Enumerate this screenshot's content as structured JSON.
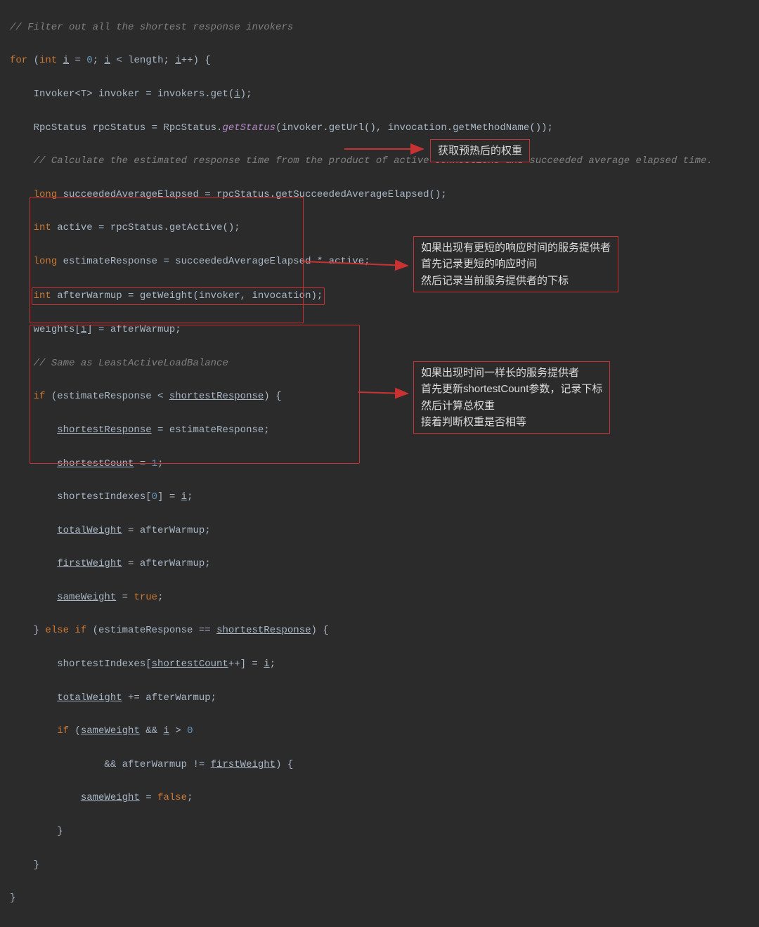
{
  "code": {
    "l1": "// Filter out all the shortest response invokers",
    "l2_for": "for",
    "l2_int": "int",
    "l2_i": "i",
    "l2_eq0": " = ",
    "l2_zero": "0",
    "l2_semi1": "; ",
    "l2_lt": " < length; ",
    "l2_inc": "++) {",
    "l3a": "Invoker<T> invoker = invokers.get(",
    "l3b": ");",
    "l4a": "RpcStatus rpcStatus = RpcStatus.",
    "l4m": "getStatus",
    "l4b": "(invoker.getUrl(), invocation.getMethodName());",
    "l5": "// Calculate the estimated response time from the product of active connections and succeeded average elapsed time.",
    "l6_long": "long",
    "l6_body": " succeededAverageElapsed = rpcStatus.getSucceededAverageElapsed();",
    "l7_int": "int",
    "l7_body": " active = rpcStatus.getActive();",
    "l8_long": "long",
    "l8_body": " estimateResponse = succeededAverageElapsed * active;",
    "l9_int": "int",
    "l9_body": " afterWarmup = getWeight(invoker, invocation);",
    "l10a": "weights[",
    "l10b": "] = afterWarmup;",
    "l11": "// Same as LeastActiveLoadBalance",
    "l12_if": "if",
    "l12_body": " (estimateResponse < ",
    "l12_sr": "shortestResponse",
    "l12_end": ") {",
    "l13_sr": "shortestResponse",
    "l13_body": " = estimateResponse;",
    "l14_sc": "shortestCount",
    "l14_body": " = ",
    "l14_one": "1",
    "l14_semi": ";",
    "l15a": "shortestIndexes[",
    "l15z": "0",
    "l15b": "] = ",
    "l15c": ";",
    "l16_tw": "totalWeight",
    "l16_body": " = afterWarmup;",
    "l17_fw": "firstWeight",
    "l17_body": " = afterWarmup;",
    "l18_sw": "sameWeight",
    "l18_body": " = ",
    "l18_true": "true",
    "l18_semi": ";",
    "l19a": "} ",
    "l19_elseif": "else if",
    "l19b": " (estimateResponse == ",
    "l19_sr": "shortestResponse",
    "l19c": ") {",
    "l20a": "shortestIndexes[",
    "l20_sc": "shortestCount",
    "l20b": "++] = ",
    "l20c": ";",
    "l21_tw": "totalWeight",
    "l21_body": " += afterWarmup;",
    "l22_if": "if",
    "l22a": " (",
    "l22_sw": "sameWeight",
    "l22b": " && ",
    "l22c": " > ",
    "l22_zero": "0",
    "l23a": "&& afterWarmup != ",
    "l23_fw": "firstWeight",
    "l23b": ") {",
    "l24_sw": "sameWeight",
    "l24_body": " = ",
    "l24_false": "false",
    "l24_semi": ";",
    "l25": "}",
    "l26": "}",
    "l27": "}"
  },
  "annotations": {
    "a1": "获取预热后的权重",
    "a2_line1": "如果出现有更短的响应时间的服务提供者",
    "a2_line2": "首先记录更短的响应时间",
    "a2_line3": "然后记录当前服务提供者的下标",
    "a3_line1": "如果出现时间一样长的服务提供者",
    "a3_line2": "首先更新shortestCount参数，记录下标",
    "a3_line3": "然后计算总权重",
    "a3_line4": "接着判断权重是否相等"
  }
}
